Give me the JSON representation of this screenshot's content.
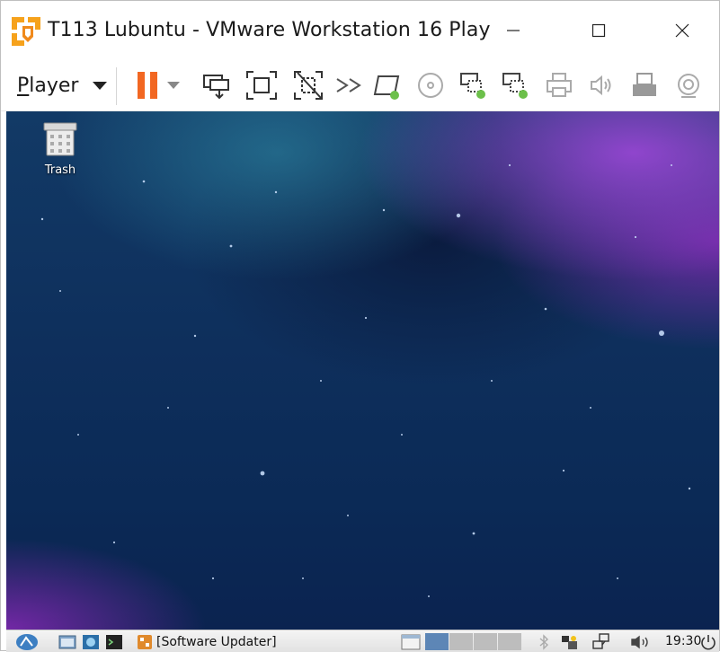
{
  "window": {
    "title": "T113 Lubuntu - VMware Workstation 16 Play",
    "controls": {
      "minimize": "minimize",
      "maximize": "maximize",
      "close": "close"
    }
  },
  "toolbar": {
    "player_menu": {
      "first_letter": "P",
      "rest": "layer"
    },
    "buttons": [
      {
        "icon": "pause-icon"
      },
      {
        "icon": "dropdown-arrow-icon"
      },
      {
        "icon": "send-ctrl-alt-del-icon"
      },
      {
        "icon": "full-screen-icon"
      },
      {
        "icon": "unity-icon"
      },
      {
        "icon": "forward-icon"
      },
      {
        "icon": "hard-disk-icon"
      },
      {
        "icon": "cd-dvd-icon"
      },
      {
        "icon": "network-adapter-icon"
      },
      {
        "icon": "network-adapter-2-icon"
      },
      {
        "icon": "printer-icon"
      },
      {
        "icon": "sound-icon"
      },
      {
        "icon": "usb-device-icon"
      },
      {
        "icon": "camera-icon"
      }
    ],
    "accent_pause": "#f26722",
    "status_green": "#6cc04a"
  },
  "desktop": {
    "icons": [
      {
        "label": "Trash",
        "icon": "trash-icon"
      }
    ]
  },
  "taskbar": {
    "task": {
      "label": "[Software Updater]",
      "icon": "software-updater-icon"
    },
    "clock": "19:30",
    "tray": [
      "bluetooth-icon",
      "update-notifier-icon",
      "network-icon",
      "volume-icon",
      "power-icon"
    ],
    "volume_label": "◀))"
  }
}
